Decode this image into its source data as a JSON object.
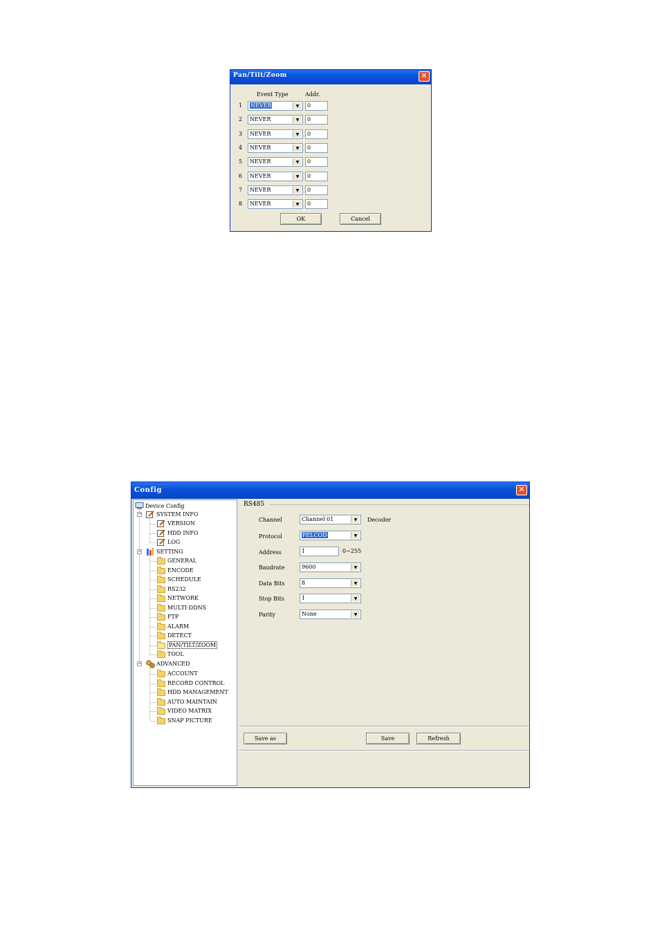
{
  "ptz_dialog": {
    "title": "Pan/Tilt/Zoom",
    "close_icon": "close-icon",
    "col_event_type": "Event Type",
    "col_addr": "Addr.",
    "rows": [
      {
        "num": "1",
        "event_type": "NEVER",
        "addr": "0"
      },
      {
        "num": "2",
        "event_type": "NEVER",
        "addr": "0"
      },
      {
        "num": "3",
        "event_type": "NEVER",
        "addr": "0"
      },
      {
        "num": "4",
        "event_type": "NEVER",
        "addr": "0"
      },
      {
        "num": "5",
        "event_type": "NEVER",
        "addr": "0"
      },
      {
        "num": "6",
        "event_type": "NEVER",
        "addr": "0"
      },
      {
        "num": "7",
        "event_type": "NEVER",
        "addr": "0"
      },
      {
        "num": "8",
        "event_type": "NEVER",
        "addr": "0"
      }
    ],
    "ok_label": "OK",
    "cancel_label": "Cancel"
  },
  "config_window": {
    "title": "Config",
    "tree": {
      "root": "Device Config",
      "system_info": "SYSTEM INFO",
      "system_items": [
        "VERSION",
        "HDD INFO",
        "LOG"
      ],
      "setting": "SETTING",
      "setting_items": [
        "GENERAL",
        "ENCODE",
        "SCHEDULE",
        "RS232",
        "NETWORK",
        "MULTI-DDNS",
        "FTP",
        "ALARM",
        "DETECT",
        "PAN/TILT/ZOOM",
        "TOOL"
      ],
      "advanced": "ADVANCED",
      "advanced_items": [
        "ACCOUNT",
        "RECORD CONTROL",
        "HDD MANAGEMENT",
        "AUTO MAINTAIN",
        "VIDEO MATRIX",
        "SNAP PICTURE"
      ],
      "selected": "PAN/TILT/ZOOM"
    },
    "panel": {
      "group_title": "RS485",
      "channel_label": "Channel",
      "channel_value": "Channel 01",
      "decoder_label": "Decoder",
      "protocol_label": "Protocol",
      "protocol_value": "PELCOD",
      "address_label": "Address",
      "address_value": "1",
      "address_range": "0~255",
      "baudrate_label": "Baudrate",
      "baudrate_value": "9600",
      "databits_label": "Data Bits",
      "databits_value": "8",
      "stopbits_label": "Stop Bits",
      "stopbits_value": "1",
      "parity_label": "Parity",
      "parity_value": "None"
    },
    "buttons": {
      "save_as": "Save as",
      "save": "Save",
      "refresh": "Refresh"
    }
  },
  "colors": {
    "titlebar": "#0a52d8",
    "dialog_bg": "#ece9d8",
    "selection": "#316ac5",
    "close_button": "#e0532c"
  }
}
